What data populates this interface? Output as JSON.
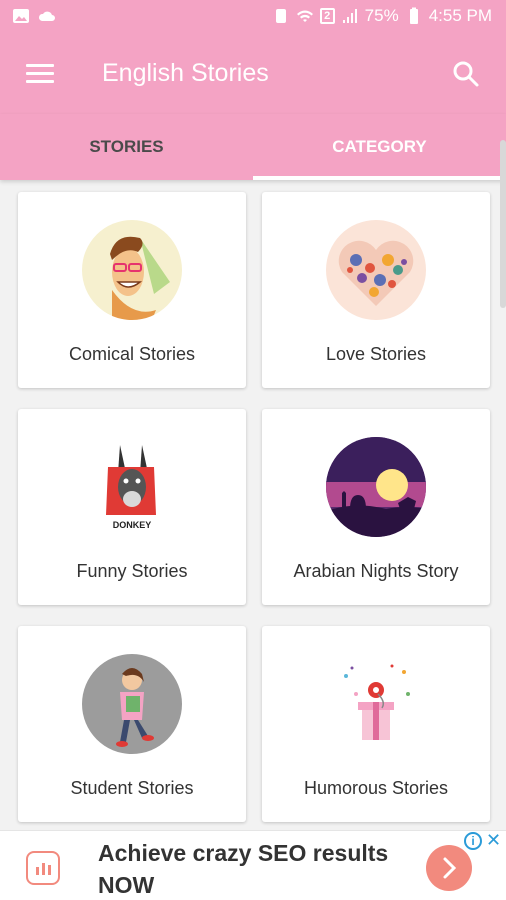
{
  "status_bar": {
    "battery": "75%",
    "time": "4:55 PM",
    "sim_badge": "2"
  },
  "app_bar": {
    "title": "English Stories"
  },
  "tabs": [
    {
      "label": "STORIES",
      "selected": false
    },
    {
      "label": "CATEGORY",
      "selected": true
    }
  ],
  "categories": [
    {
      "label": "Comical Stories",
      "icon": "cartoon-man-icon"
    },
    {
      "label": "Love Stories",
      "icon": "floral-heart-icon"
    },
    {
      "label": "Funny Stories",
      "icon": "donkey-icon"
    },
    {
      "label": "Arabian Nights Story",
      "icon": "desert-night-icon"
    },
    {
      "label": "Student Stories",
      "icon": "student-girl-icon"
    },
    {
      "label": "Humorous Stories",
      "icon": "gift-box-icon"
    }
  ],
  "donkey_logo_text": "DONKEY",
  "ad": {
    "text": "Achieve crazy SEO results NOW",
    "info_glyph": "i",
    "close_glyph": "✕"
  },
  "colors": {
    "primary": "#f4a3c4",
    "accent": "#f28a7e",
    "ad_info": "#2b9bd8"
  }
}
